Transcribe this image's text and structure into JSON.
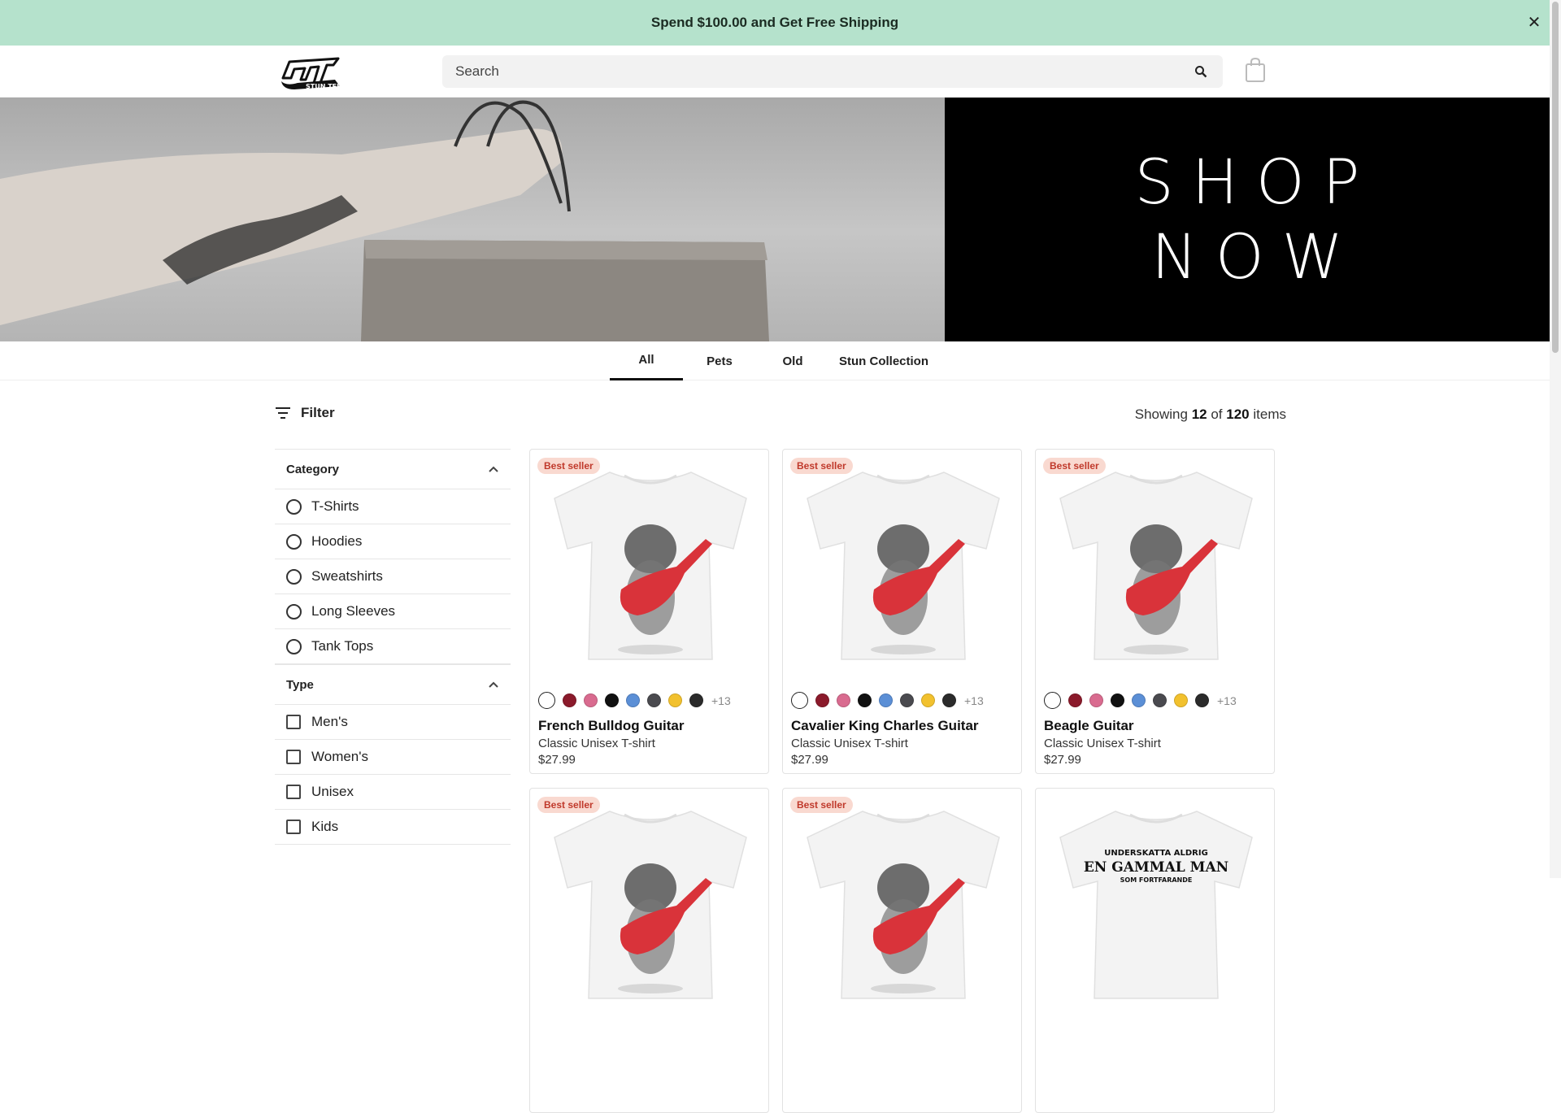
{
  "banner": {
    "text": "Spend $100.00 and Get Free Shipping",
    "close_icon": "close-icon",
    "bg_color": "#b5e2cc"
  },
  "header": {
    "logo_text": "STUN TEE",
    "search_placeholder": "Search",
    "search_icon": "search-icon",
    "cart_icon": "shopping-bag-icon"
  },
  "hero": {
    "line1": "SHOP",
    "line2": "NOW"
  },
  "tabs": [
    {
      "label": "All",
      "active": true
    },
    {
      "label": "Pets",
      "active": false
    },
    {
      "label": "Old",
      "active": false
    },
    {
      "label": "Stun Collection",
      "active": false
    }
  ],
  "toolbar": {
    "filter_label": "Filter",
    "showing_prefix": "Showing",
    "showing_count": "12",
    "showing_of": "of",
    "showing_total": "120",
    "showing_suffix": "items"
  },
  "filters": {
    "category": {
      "title": "Category",
      "options": [
        "T-Shirts",
        "Hoodies",
        "Sweatshirts",
        "Long Sleeves",
        "Tank Tops"
      ]
    },
    "type": {
      "title": "Type",
      "options": [
        "Men's",
        "Women's",
        "Unisex",
        "Kids"
      ]
    }
  },
  "swatch_colors": [
    "#ffffff",
    "#8b1a2b",
    "#d96b8f",
    "#111111",
    "#5b8fd6",
    "#4a4a4f",
    "#f2c12e",
    "#2b2b2b"
  ],
  "products": [
    {
      "badge": "Best seller",
      "name": "French Bulldog Guitar",
      "type": "Classic Unisex T-shirt",
      "price": "$27.99",
      "more": "+13"
    },
    {
      "badge": "Best seller",
      "name": "Cavalier King Charles Guitar",
      "type": "Classic Unisex T-shirt",
      "price": "$27.99",
      "more": "+13"
    },
    {
      "badge": "Best seller",
      "name": "Beagle Guitar",
      "type": "Classic Unisex T-shirt",
      "price": "$27.99",
      "more": "+13"
    },
    {
      "badge": "Best seller"
    },
    {
      "badge": "Best seller"
    },
    {
      "print_line1": "UNDERSKATTA ALDRIG",
      "print_line2": "EN GAMMAL MAN",
      "print_line3": "SOM FORTFARANDE"
    }
  ]
}
